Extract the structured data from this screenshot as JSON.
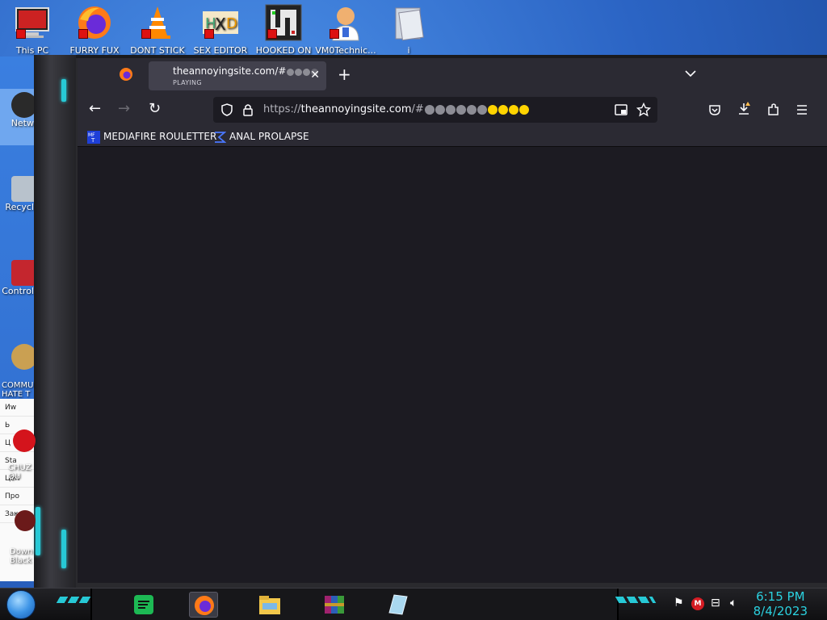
{
  "desktop": {
    "top_icons": [
      {
        "label": "This PC",
        "icon": "computer-icon"
      },
      {
        "label": "FURRY FUX",
        "icon": "firefox-icon"
      },
      {
        "label": "DONT STICK",
        "icon": "vlc-cone-icon"
      },
      {
        "label": "SEX EDITOR",
        "icon": "hxd-icon"
      },
      {
        "label": "HOOKED ON",
        "icon": "maze-icon"
      },
      {
        "label": "VM0Technic...",
        "icon": "doctor-icon"
      },
      {
        "label": "i",
        "icon": "files-icon"
      }
    ],
    "left_items": [
      {
        "label": "Netw",
        "icon": "network-icon"
      },
      {
        "label": "Recycl",
        "icon": "recycle-bin-icon"
      },
      {
        "label": "Control",
        "icon": "control-panel-icon"
      },
      {
        "label": "COMMU\nHATE T",
        "icon": "money-bag-icon"
      },
      {
        "label": "CHUZ\nQU",
        "icon": "red-ball-icon"
      },
      {
        "label": "Down\nBlack",
        "icon": "download-icon"
      }
    ],
    "explorer_rows": [
      "Иw",
      "Ь",
      "Ц",
      "Sta",
      "Цен",
      "Про",
      "Зак"
    ]
  },
  "browser": {
    "tab": {
      "title": "theannoyingsite.com/#",
      "subtitle": "PLAYING",
      "close": "✕"
    },
    "new_tab": "+",
    "tab_list": "⌄",
    "nav": {
      "back": "←",
      "forward": "→",
      "reload": "↻"
    },
    "url": {
      "scheme": "https://",
      "host": "theannoyingsite.com",
      "path": "/#",
      "grey_dots": 6,
      "yellow_dots": 4
    },
    "bookmarks": [
      {
        "label": "MEDIAFIRE ROULETTER",
        "icon": "mft-icon"
      },
      {
        "label": "ANAL PROLAPSE",
        "icon": "sigma-icon"
      }
    ],
    "toolbar_icons": [
      "pocket-icon",
      "download-icon",
      "extensions-icon",
      "menu-icon"
    ]
  },
  "taskbar": {
    "apps": [
      "spotify-icon",
      "firefox-icon",
      "file-explorer-icon",
      "winrar-icon",
      "notepad-icon"
    ],
    "clock": {
      "time": "6:15 PM",
      "date": "8/4/2023"
    }
  },
  "colors": {
    "browser_bg": "#1c1b22",
    "toolbar_bg": "#2b2a33",
    "tab_active": "#42414d",
    "accent_cyan": "#2bd1df"
  }
}
